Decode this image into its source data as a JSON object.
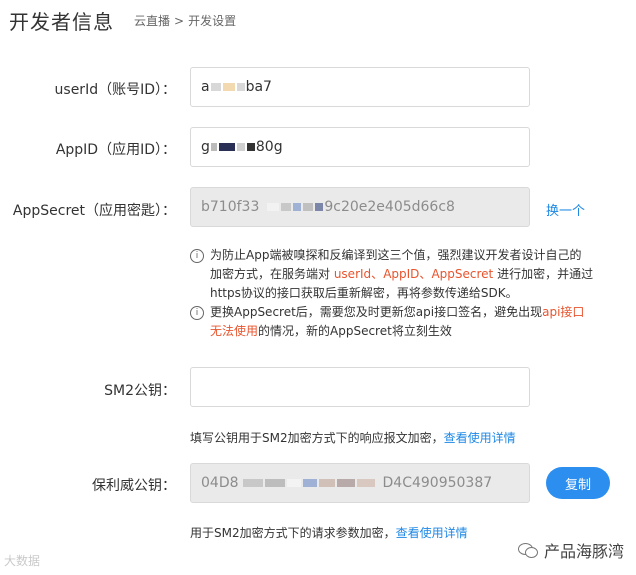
{
  "header": {
    "title": "开发者信息",
    "breadcrumb": [
      "云直播",
      "开发设置"
    ],
    "breadcrumb_sep": ">"
  },
  "fields": {
    "userid": {
      "label": "userId（账号ID）：",
      "value_start": "a",
      "value_end": "ba7"
    },
    "appid": {
      "label": "AppID（应用ID）：",
      "value_start": "g",
      "value_end": "80g"
    },
    "appsecret": {
      "label": "AppSecret（应用密匙）：",
      "value_start": "b710f33",
      "value_end": "9c20e2e405d66c8",
      "action": "换一个"
    },
    "sm2": {
      "label": "SM2公钥：",
      "value": "",
      "hint": "填写公钥用于SM2加密方式下的响应报文加密，",
      "hint_link": "查看使用详情"
    },
    "baoliwei": {
      "label": "保利威公钥：",
      "value_start": "04D8",
      "value_end": "D4C490950387",
      "action": "复制",
      "hint": "用于SM2加密方式下的请求参数加密，",
      "hint_link": "查看使用详情"
    }
  },
  "notice": {
    "line1_a": "为防止App端被嗅探和反编译到这三个值，强烈建议开发者设计自己的",
    "line1_b": "加密方式，在服务端对 ",
    "hl_userid": "userId",
    "sep1": "、",
    "hl_appid": "AppID",
    "sep2": "、",
    "hl_appsecret": "AppSecret",
    "line1_c": " 进行加密，并通过",
    "line1_d": "https协议的接口获取后重新解密，再将参数传递给SDK。",
    "line2_a": "更换AppSecret后，需要您及时更新您api接口签名，避免出现",
    "line2_hl": "api接口无法使用",
    "line2_b": "的情况，新的AppSecret将立刻生效"
  },
  "watermark": {
    "left": "大数据",
    "right": "产品海豚湾"
  },
  "colors": {
    "accent": "#2c8ff0",
    "link": "#1e88e5",
    "highlight": "#e8542d",
    "disabled_bg": "#eaeaea"
  }
}
